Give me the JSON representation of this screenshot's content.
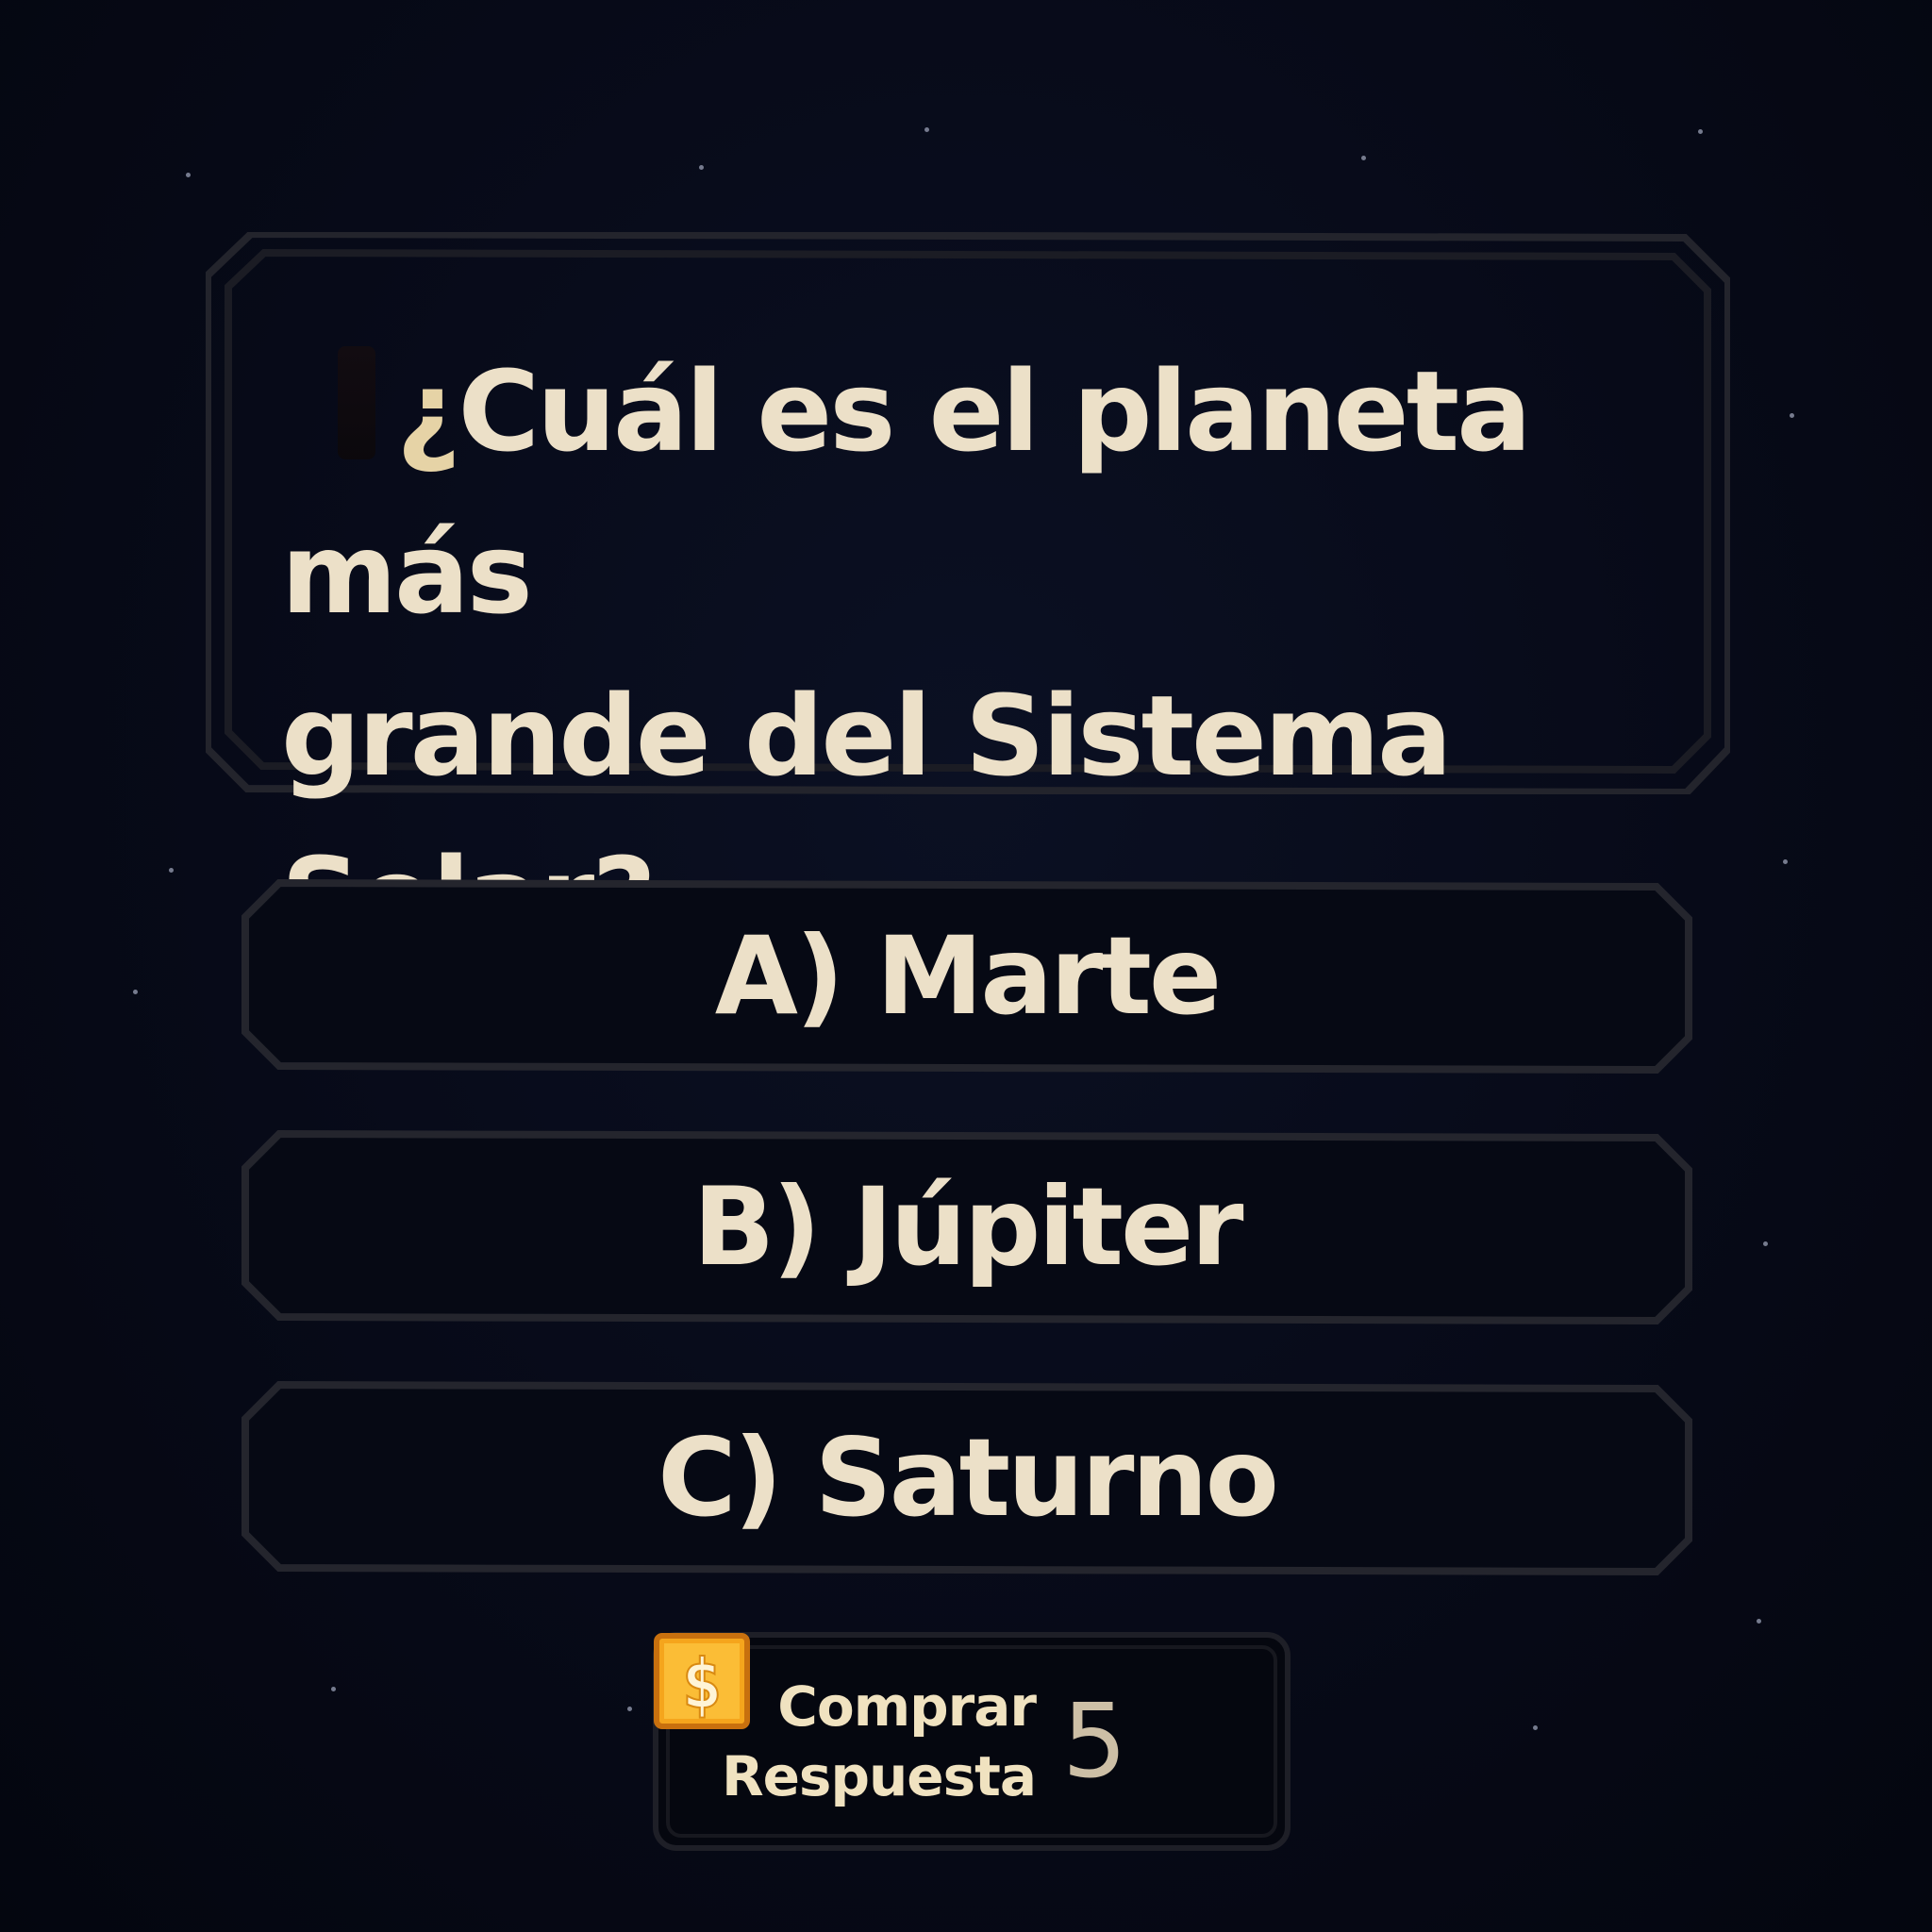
{
  "question": {
    "mark": "¿",
    "line1": "Cuál es el planeta más",
    "line2": "grande del Sistema Solar?"
  },
  "options": [
    {
      "label": "A) Marte"
    },
    {
      "label": "B) Júpiter"
    },
    {
      "label": "C) Saturno"
    }
  ],
  "buy_answer": {
    "line1": "Comprar",
    "line2": "Respuesta",
    "price": "5",
    "currency_icon": "coin-dollar-icon"
  },
  "colors": {
    "background": "#070a17",
    "text": "#ece0c8",
    "frame": "#2a2b33",
    "coin": "#f5a51c"
  }
}
